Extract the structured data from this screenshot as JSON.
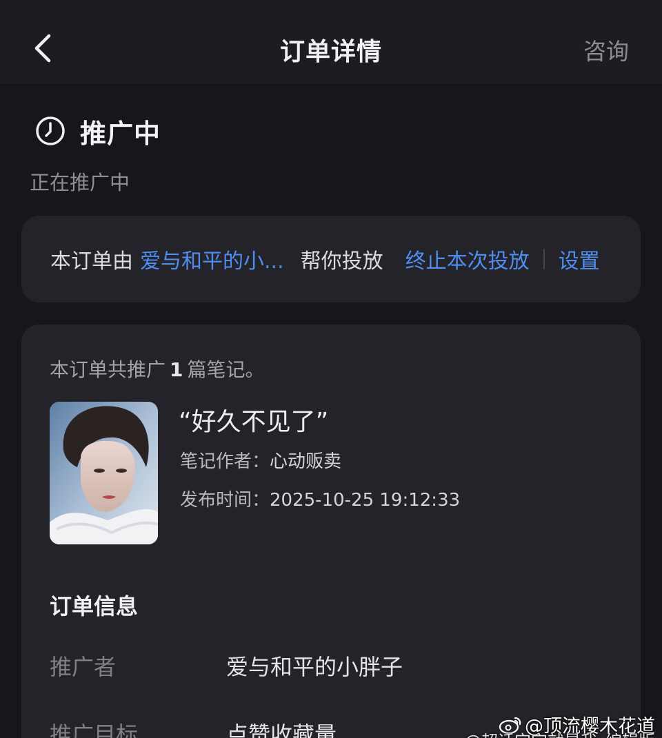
{
  "header": {
    "title": "订单详情",
    "consult_label": "咨询"
  },
  "status": {
    "title": "推广中",
    "subtitle": "正在推广中"
  },
  "notice": {
    "prefix": "本订单由",
    "promoter_link": "爱与和平的小...",
    "middle": "帮你投放",
    "stop_link": "终止本次投放",
    "settings_link": "设置"
  },
  "note_summary": {
    "prefix": "本订单共推广",
    "count": "1",
    "suffix": "篇笔记。"
  },
  "note": {
    "title": "“好久不见了”",
    "author_label": "笔记作者：",
    "author": "心动贩卖",
    "time_label": "发布时间：",
    "time": "2025-10-25 19:12:33"
  },
  "order_info": {
    "section_title": "订单信息",
    "rows": [
      {
        "label": "推广者",
        "value": "爱与和平的小胖子"
      },
      {
        "label": "推广目标",
        "value": "点赞收藏量"
      }
    ]
  },
  "watermark": {
    "line1": "@顶流樱木花道",
    "line2": "@超话宝宝就是我_编辑版"
  },
  "colors": {
    "background": "#16161c",
    "card": "#232329",
    "link": "#4f8ef0"
  },
  "icons": {
    "back": "chevron-left-icon",
    "status": "clock-icon",
    "watermark": "weibo-icon"
  }
}
